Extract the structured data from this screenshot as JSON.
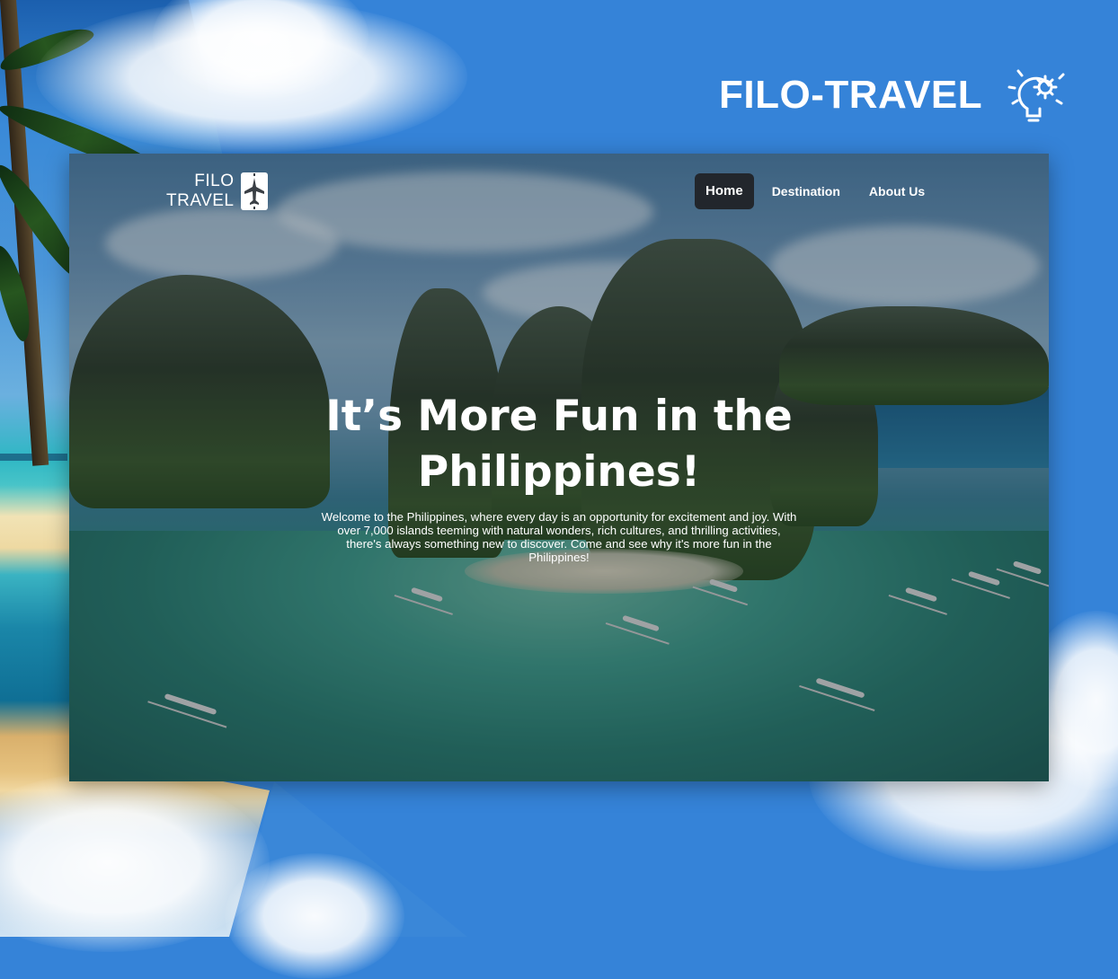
{
  "brand": {
    "title": "FILO-TRAVEL",
    "icon": "lightbulb-gear-icon"
  },
  "site": {
    "logo": {
      "line1": "FILO",
      "line2": "TRAVEL",
      "icon": "airplane-icon"
    },
    "nav": [
      {
        "label": "Home",
        "active": true
      },
      {
        "label": "Destination",
        "active": false
      },
      {
        "label": "About Us",
        "active": false
      }
    ],
    "hero": {
      "title": "It’s More Fun in the Philippines!",
      "text": "Welcome to the Philippines, where every day is an opportunity for excitement and joy. With over 7,000 islands teeming with natural wonders, rich cultures, and thrilling activities, there's always something new to discover. Come and see why it's more fun in the Philippines!"
    }
  },
  "colors": {
    "background": "#3583d8",
    "nav_active": "#22262c",
    "text": "#ffffff"
  }
}
